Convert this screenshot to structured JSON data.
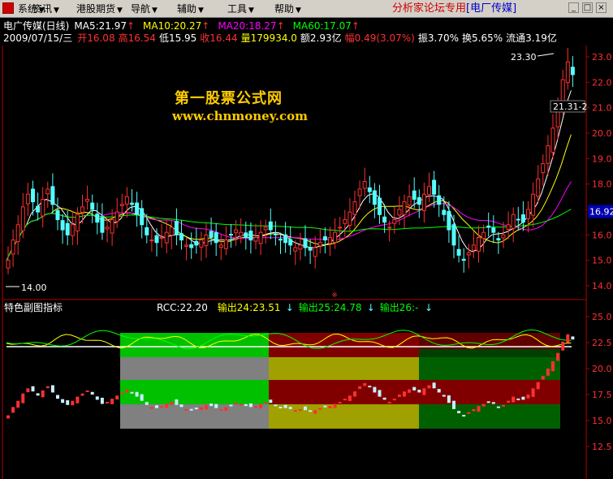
{
  "menu": {
    "items": [
      {
        "label": "系统",
        "arrow": "▼"
      },
      {
        "label": "资讯",
        "arrow": "▼"
      },
      {
        "label": "港股期货",
        "arrow": "▼"
      },
      {
        "label": "导航",
        "arrow": "▼"
      },
      {
        "label": "辅助",
        "arrow": "▼"
      },
      {
        "label": "工具",
        "arrow": "▼"
      },
      {
        "label": "帮助",
        "arrow": "▼"
      }
    ],
    "ad_text": "分析家论坛专用",
    "ad_link": "[电厂传媒]",
    "window_controls": [
      "_",
      "□",
      "×"
    ]
  },
  "stock": {
    "name": "电广传媒(日线)",
    "ma": [
      {
        "label": "MA5:21.97",
        "color": "#ffffff"
      },
      {
        "label": "MA10:20.27",
        "color": "#ffff00"
      },
      {
        "label": "MA20:18.27",
        "color": "#ff00ff"
      },
      {
        "label": "MA60:17.07",
        "color": "#00ff00"
      }
    ],
    "ma_arrow": "↑",
    "date": "2009/07/15/三",
    "quote": [
      {
        "label": "开16.08",
        "color": "#ff3030"
      },
      {
        "label": "高16.54",
        "color": "#ff3030"
      },
      {
        "label": "低15.95",
        "color": "#ffffff"
      },
      {
        "label": "收16.44",
        "color": "#ff3030"
      },
      {
        "label": "量179934.0",
        "color": "#ffff00"
      },
      {
        "label": "额2.93亿",
        "color": "#ffffff"
      },
      {
        "label": "幅0.49(3.07%)",
        "color": "#ff3030"
      },
      {
        "label": "振3.70%",
        "color": "#ffffff"
      },
      {
        "label": "换5.65%",
        "color": "#ffffff"
      },
      {
        "label": "流通3.19亿",
        "color": "#ffffff"
      }
    ]
  },
  "watermark": {
    "title": "第一股票公式网",
    "url": "www.chnmoney.com"
  },
  "main_chart": {
    "y_ticks": [
      "23.0",
      "22.0",
      "21.0",
      "20.0",
      "19.0",
      "18.0",
      "17.0",
      "16.0",
      "15.0",
      "14.0"
    ],
    "current_price": "16.92",
    "high_label": "23.30",
    "low_label": "14.00",
    "right_label": "21.31-2"
  },
  "sub_chart": {
    "title": "特色副图指标",
    "indicators": [
      {
        "label": "RCC:22.20",
        "color": "#ffffff"
      },
      {
        "label": "输出24:23.51",
        "color": "#ffff00"
      },
      {
        "label": "输出25:24.78",
        "color": "#00ff00"
      },
      {
        "label": "输出26:-",
        "color": "#00ff00"
      }
    ],
    "arrow": "↓",
    "y_ticks": [
      "25.0",
      "22.5",
      "20.0",
      "17.5",
      "15.0",
      "12.5"
    ]
  },
  "colors": {
    "up": "#ff3030",
    "down": "#54ffff",
    "grid": "#8b0000",
    "axis": "#b00000"
  }
}
